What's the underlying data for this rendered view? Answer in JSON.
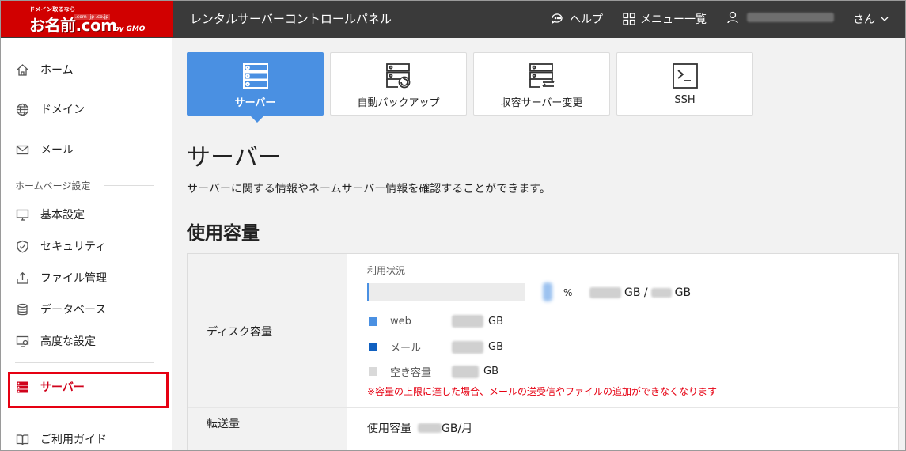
{
  "header": {
    "logo_tagline": "ドメイン取るなら",
    "logo_text": "お名前.com",
    "logo_domains": ".com .jp .co.jp",
    "logo_brand": "by GMO",
    "title": "レンタルサーバーコントロールパネル",
    "help_label": "ヘルプ",
    "menu_label": "メニュー一覧",
    "user_suffix": "さん"
  },
  "sidebar": {
    "items_top": [
      {
        "label": "ホーム",
        "icon": "home-icon"
      },
      {
        "label": "ドメイン",
        "icon": "globe-icon"
      },
      {
        "label": "メール",
        "icon": "mail-icon"
      }
    ],
    "section_label": "ホームページ設定",
    "items_site": [
      {
        "label": "基本設定",
        "icon": "monitor-icon"
      },
      {
        "label": "セキュリティ",
        "icon": "shield-icon"
      },
      {
        "label": "ファイル管理",
        "icon": "upload-icon"
      },
      {
        "label": "データベース",
        "icon": "database-icon"
      },
      {
        "label": "高度な設定",
        "icon": "settings-monitor-icon"
      }
    ],
    "active_item": {
      "label": "サーバー",
      "icon": "server-icon"
    },
    "guide_item": {
      "label": "ご利用ガイド",
      "icon": "book-icon"
    }
  },
  "tabs": [
    {
      "label": "サーバー",
      "icon": "server-icon",
      "active": true
    },
    {
      "label": "自動バックアップ",
      "icon": "backup-icon",
      "active": false
    },
    {
      "label": "収容サーバー変更",
      "icon": "server-transfer-icon",
      "active": false
    },
    {
      "label": "SSH",
      "icon": "terminal-icon",
      "active": false
    }
  ],
  "page": {
    "title": "サーバー",
    "description": "サーバーに関する情報やネームサーバー情報を確認することができます。"
  },
  "usage": {
    "section_title": "使用容量",
    "disk_label": "ディスク容量",
    "status_label": "利用状況",
    "percent_symbol": "%",
    "usage_fraction": 0.01,
    "gb_unit": "GB",
    "total_separator": "GB /",
    "legend": [
      {
        "name": "web",
        "unit": "GB",
        "color": "#4a90e2"
      },
      {
        "name": "メール",
        "unit": "GB",
        "color": "#1060c0"
      },
      {
        "name": "空き容量",
        "unit": "GB",
        "color": "#d9d9d9"
      }
    ],
    "warning": "※容量の上限に達した場合、メールの送受信やファイルの追加ができなくなります",
    "transfer_label": "転送量",
    "transfer_used_label": "使用容量",
    "transfer_unit": "GB/月"
  }
}
